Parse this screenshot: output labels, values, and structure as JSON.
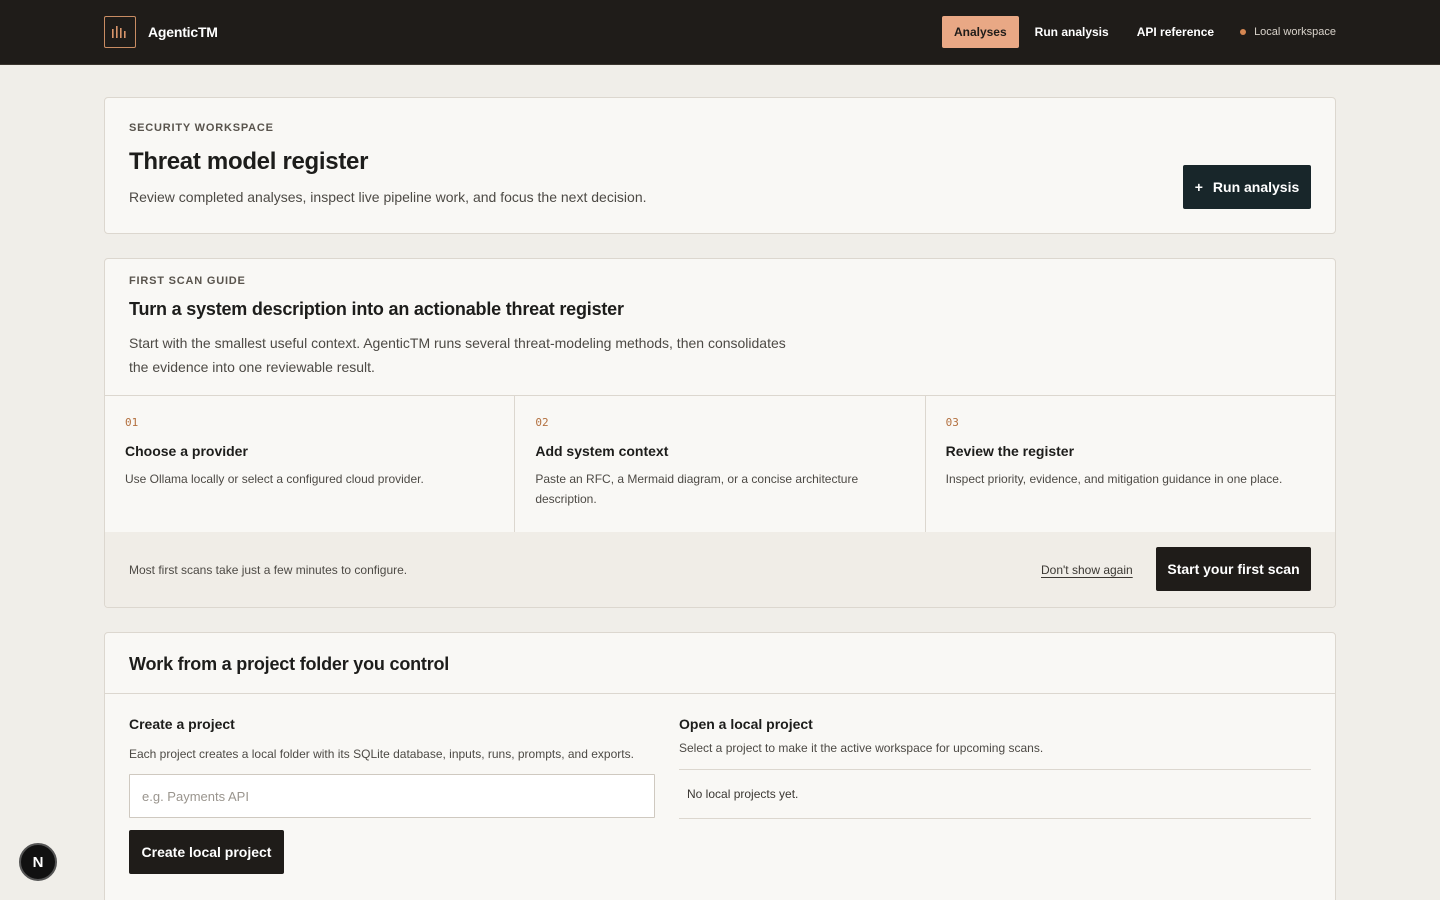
{
  "app": {
    "name": "AgenticTM",
    "logo_icon": "bars-icon"
  },
  "nav": {
    "items": [
      {
        "label": "Analyses",
        "active": true
      },
      {
        "label": "Run analysis",
        "active": false
      },
      {
        "label": "API reference",
        "active": false
      }
    ],
    "status": "Local workspace",
    "status_color": "#d58752"
  },
  "header_card": {
    "eyebrow": "SECURITY WORKSPACE",
    "title": "Threat model register",
    "description": "Review completed analyses, inspect live pipeline work, and focus the next decision.",
    "button_icon": "+",
    "button_label": "Run analysis"
  },
  "guide": {
    "eyebrow": "FIRST SCAN GUIDE",
    "title": "Turn a system description into an actionable threat register",
    "description": "Start with the smallest useful context. AgenticTM runs several threat-modeling methods, then consolidates the evidence into one reviewable result.",
    "steps": [
      {
        "num": "01",
        "title": "Choose a provider",
        "desc": "Use Ollama locally or select a configured cloud provider."
      },
      {
        "num": "02",
        "title": "Add system context",
        "desc": "Paste an RFC, a Mermaid diagram, or a concise architecture description."
      },
      {
        "num": "03",
        "title": "Review the register",
        "desc": "Inspect priority, evidence, and mitigation guidance in one place."
      }
    ],
    "footer_note": "Most first scans take just a few minutes to configure.",
    "dismiss_label": "Don't show again",
    "start_label": "Start your first scan"
  },
  "projects": {
    "title": "Work from a project folder you control",
    "create": {
      "title": "Create a project",
      "description": "Each project creates a local folder with its SQLite database, inputs, runs, prompts, and exports.",
      "placeholder": "e.g. Payments API",
      "value": "",
      "button_label": "Create local project"
    },
    "open": {
      "title": "Open a local project",
      "description": "Select a project to make it the active workspace for upcoming scans.",
      "empty_text": "No local projects yet."
    }
  },
  "fab": {
    "label": "N"
  },
  "colors": {
    "topbar": "#1f1c19",
    "accent": "#e9a885",
    "primary_button": "#18262a",
    "background": "#f0eee9"
  }
}
